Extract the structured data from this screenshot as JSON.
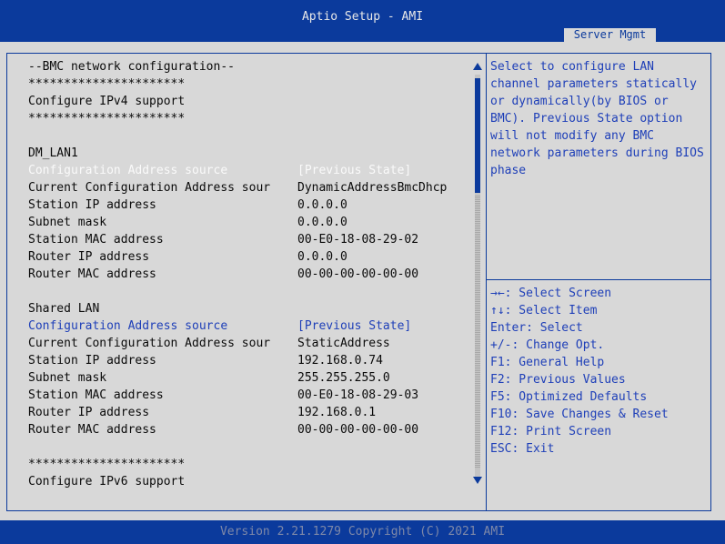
{
  "header": {
    "title": "Aptio Setup - AMI",
    "tab": "Server Mgmt"
  },
  "rows": [
    {
      "label": "--BMC network configuration--",
      "value": "",
      "style": "normal"
    },
    {
      "label": "**********************",
      "value": "",
      "style": "normal"
    },
    {
      "label": "Configure IPv4 support",
      "value": "",
      "style": "normal"
    },
    {
      "label": "**********************",
      "value": "",
      "style": "normal"
    },
    {
      "label": "",
      "value": "",
      "style": "normal"
    },
    {
      "label": "DM_LAN1",
      "value": "",
      "style": "normal"
    },
    {
      "label": "Configuration Address source",
      "value": "[Previous State]",
      "style": "selected"
    },
    {
      "label": "Current Configuration Address sour",
      "value": "DynamicAddressBmcDhcp",
      "style": "normal"
    },
    {
      "label": "Station IP address",
      "value": "0.0.0.0",
      "style": "normal"
    },
    {
      "label": "Subnet mask",
      "value": "0.0.0.0",
      "style": "normal"
    },
    {
      "label": "Station MAC address",
      "value": "00-E0-18-08-29-02",
      "style": "normal"
    },
    {
      "label": "Router IP address",
      "value": "0.0.0.0",
      "style": "normal"
    },
    {
      "label": "Router MAC address",
      "value": "00-00-00-00-00-00",
      "style": "normal"
    },
    {
      "label": "",
      "value": "",
      "style": "normal"
    },
    {
      "label": "Shared LAN",
      "value": "",
      "style": "normal"
    },
    {
      "label": "Configuration Address source",
      "value": "[Previous State]",
      "style": "option"
    },
    {
      "label": "Current Configuration Address sour",
      "value": "StaticAddress",
      "style": "normal"
    },
    {
      "label": "Station IP address",
      "value": "192.168.0.74",
      "style": "normal"
    },
    {
      "label": "Subnet mask",
      "value": "255.255.255.0",
      "style": "normal"
    },
    {
      "label": "Station MAC address",
      "value": "00-E0-18-08-29-03",
      "style": "normal"
    },
    {
      "label": "Router IP address",
      "value": "192.168.0.1",
      "style": "normal"
    },
    {
      "label": "Router MAC address",
      "value": "00-00-00-00-00-00",
      "style": "normal"
    },
    {
      "label": "",
      "value": "",
      "style": "normal"
    },
    {
      "label": "**********************",
      "value": "",
      "style": "normal"
    },
    {
      "label": "Configure IPv6 support",
      "value": "",
      "style": "normal"
    }
  ],
  "help_text": "Select to configure LAN\nchannel parameters statically\nor dynamically(by BIOS or\nBMC). Previous State option\nwill not modify any BMC\nnetwork parameters during BIOS\nphase",
  "keys": [
    "→←: Select Screen",
    "↑↓: Select Item",
    "Enter: Select",
    "+/-: Change Opt.",
    "F1: General Help",
    "F2: Previous Values",
    "F5: Optimized Defaults",
    "F10: Save Changes & Reset",
    "F12: Print Screen",
    "ESC: Exit"
  ],
  "footer": {
    "version": "Version 2.21.1279 Copyright (C) 2021 AMI"
  },
  "colors": {
    "accent": "#0b3a9c",
    "panel": "#d8d8d8",
    "selected": "#fafafa",
    "option": "#1e3fb8"
  }
}
